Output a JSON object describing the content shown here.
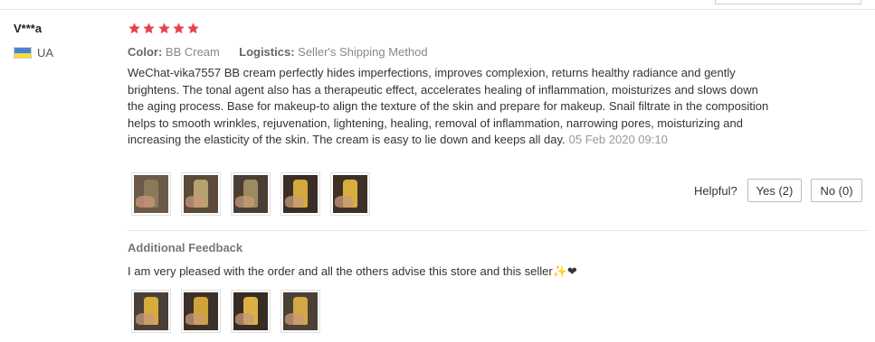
{
  "user": {
    "name": "V***a",
    "country_code": "UA",
    "flag_colors": [
      "#4a83d4",
      "#f4de3d"
    ]
  },
  "rating": {
    "stars": 5,
    "max": 5,
    "color": "#e8424a"
  },
  "meta": {
    "color_label": "Color:",
    "color_value": "BB Cream",
    "logistics_label": "Logistics:",
    "logistics_value": "Seller's Shipping Method"
  },
  "review": {
    "text": "WeChat-vika7557 BB cream perfectly hides imperfections, improves complexion, returns healthy radiance and gently brightens. The tonal agent also has a therapeutic effect, accelerates healing of inflammation, moisturizes and slows down the aging process. Base for makeup-to align the texture of the skin and prepare for makeup. Snail filtrate in the composition helps to smooth wrinkles, rejuvenation, lightening, healing, removal of inflammation, narrowing pores, moisturizing and increasing the elasticity of the skin. The cream is easy to lie down and keeps all day.",
    "date": "05 Feb 2020 09:10",
    "photos": [
      {
        "bg": "#6b5a4a",
        "tube": "#8a7a5a"
      },
      {
        "bg": "#5a4a3a",
        "tube": "#b8a070"
      },
      {
        "bg": "#4a3e34",
        "tube": "#9c8a60"
      },
      {
        "bg": "#3a2e26",
        "tube": "#d2a93a"
      },
      {
        "bg": "#3e3026",
        "tube": "#d8ad3e"
      }
    ]
  },
  "helpful": {
    "label": "Helpful?",
    "yes_label": "Yes (2)",
    "no_label": "No (0)"
  },
  "feedback": {
    "title": "Additional Feedback",
    "text": "I am very pleased with the order and all the others advise this store and this seller✨❤",
    "photos": [
      {
        "bg": "#4a4038",
        "tube": "#d6ab3c"
      },
      {
        "bg": "#3c3028",
        "tube": "#d0a23a"
      },
      {
        "bg": "#362c24",
        "tube": "#dab045"
      },
      {
        "bg": "#4a4036",
        "tube": "#d4a840"
      }
    ]
  }
}
